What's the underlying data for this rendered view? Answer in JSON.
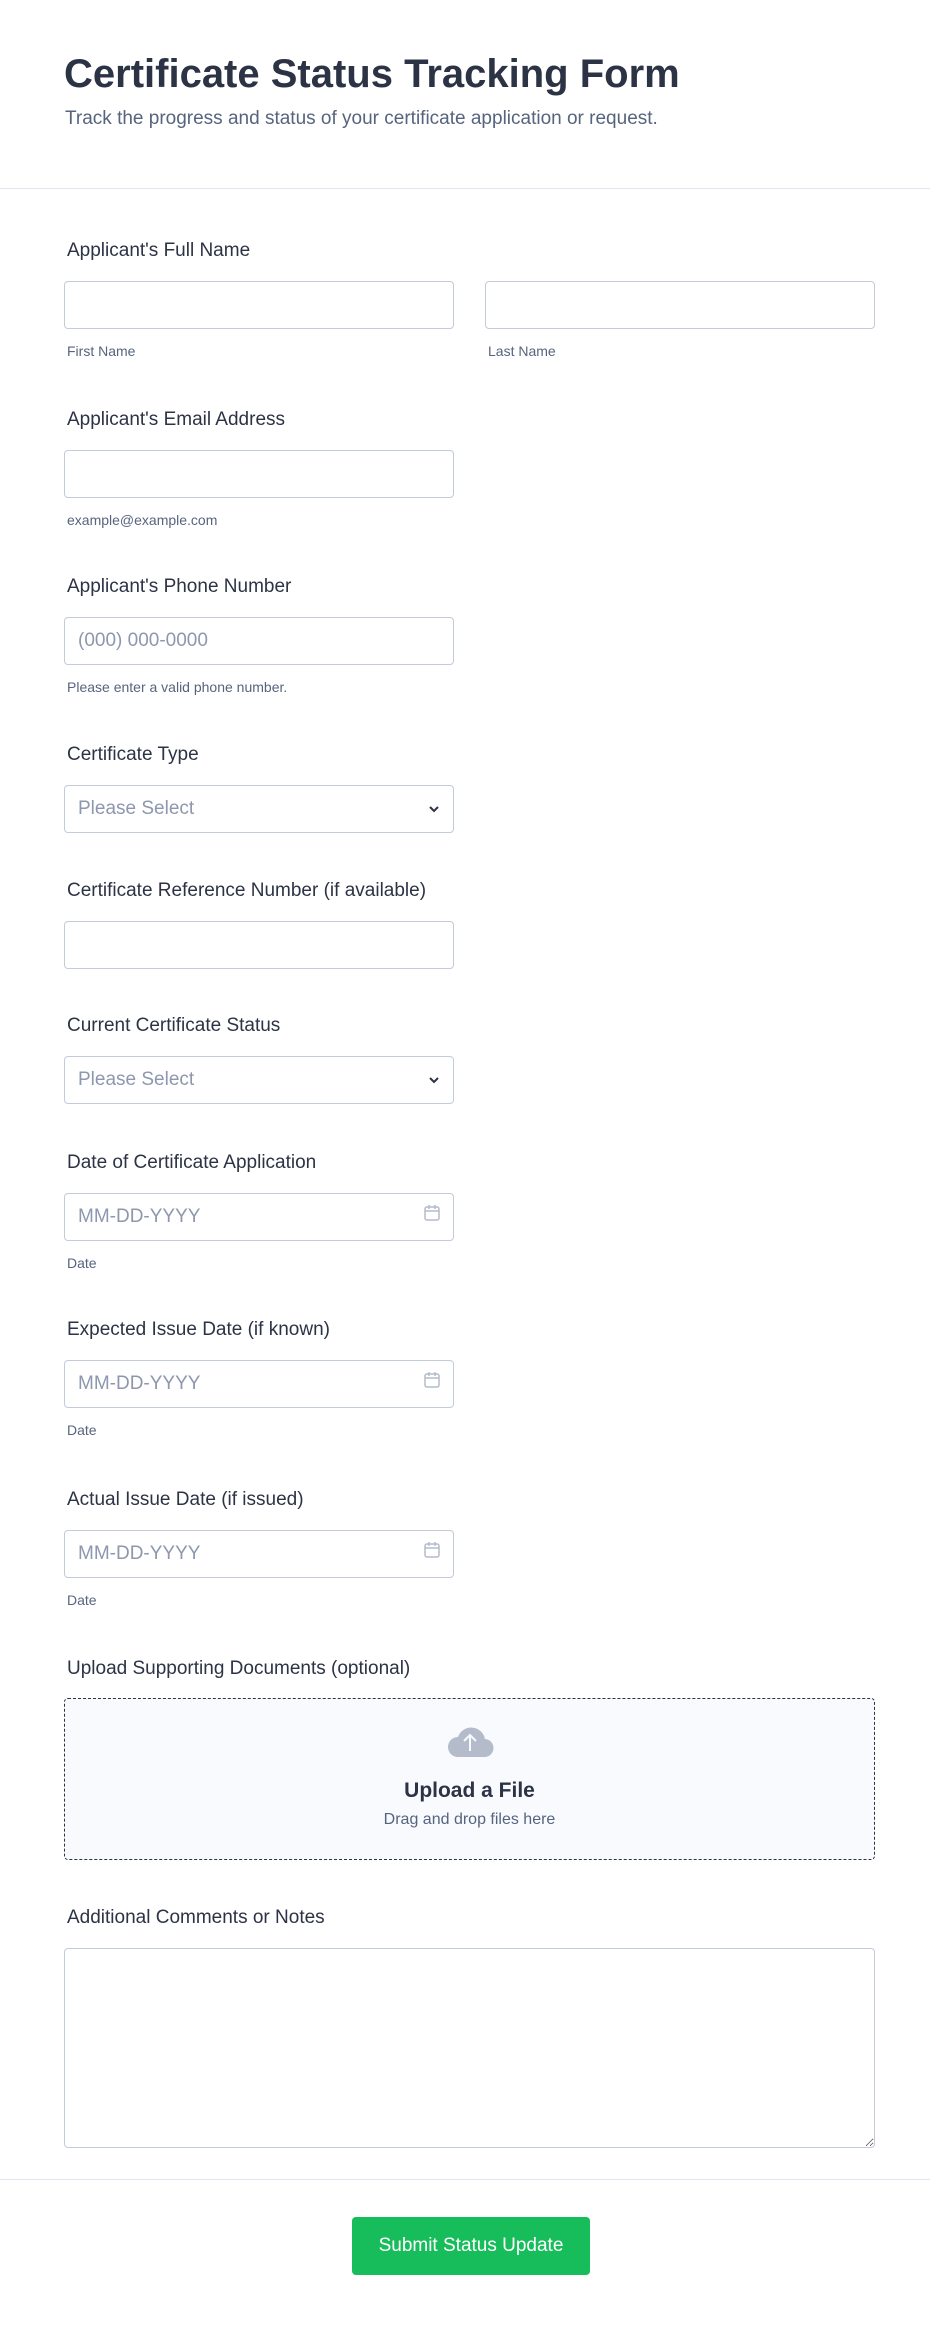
{
  "header": {
    "title": "Certificate Status Tracking Form",
    "subtitle": "Track the progress and status of your certificate application or request."
  },
  "fields": {
    "full_name": {
      "label": "Applicant's Full Name",
      "first_sub": "First Name",
      "last_sub": "Last Name"
    },
    "email": {
      "label": "Applicant's Email Address",
      "sub": "example@example.com"
    },
    "phone": {
      "label": "Applicant's Phone Number",
      "placeholder": "(000) 000-0000",
      "sub": "Please enter a valid phone number."
    },
    "certificate_type": {
      "label": "Certificate Type",
      "value": "Please Select"
    },
    "reference": {
      "label": "Certificate Reference Number (if available)"
    },
    "status": {
      "label": "Current Certificate Status",
      "value": "Please Select"
    },
    "application_date": {
      "label": "Date of Certificate Application",
      "placeholder": "MM-DD-YYYY",
      "sub": "Date"
    },
    "expected_date": {
      "label": "Expected Issue Date (if known)",
      "placeholder": "MM-DD-YYYY",
      "sub": "Date"
    },
    "actual_date": {
      "label": "Actual Issue Date (if issued)",
      "placeholder": "MM-DD-YYYY",
      "sub": "Date"
    },
    "upload": {
      "label": "Upload Supporting Documents (optional)",
      "title": "Upload a File",
      "sub": "Drag and drop files here"
    },
    "comments": {
      "label": "Additional Comments or Notes"
    }
  },
  "submit_label": "Submit Status Update",
  "colors": {
    "accent": "#18bd5b",
    "text": "#2c3345",
    "border": "#c3cad8"
  }
}
